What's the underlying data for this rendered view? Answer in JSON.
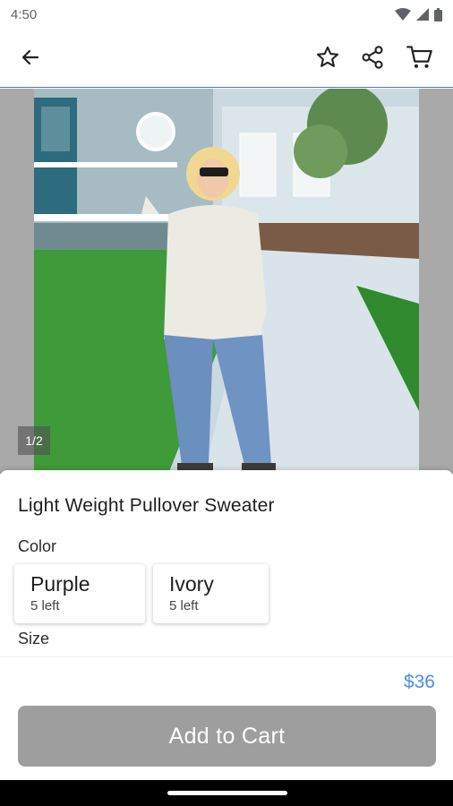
{
  "status": {
    "time": "4:50"
  },
  "toolbar": {
    "back": "back-arrow-icon",
    "favorite": "star-icon",
    "share": "share-icon",
    "cart": "cart-icon"
  },
  "gallery": {
    "pager": "1/2"
  },
  "product": {
    "title": "Light Weight Pullover Sweater",
    "color_label": "Color",
    "colors": [
      {
        "name": "Purple",
        "stock": "5 left"
      },
      {
        "name": "Ivory",
        "stock": "5 left"
      }
    ],
    "size_label": "Size"
  },
  "footer": {
    "price": "$36",
    "add_to_cart": "Add to Cart"
  },
  "colors": {
    "accent": "#4a8fe0",
    "button_disabled": "#9e9e9e",
    "divider": "#4a7ac4"
  }
}
